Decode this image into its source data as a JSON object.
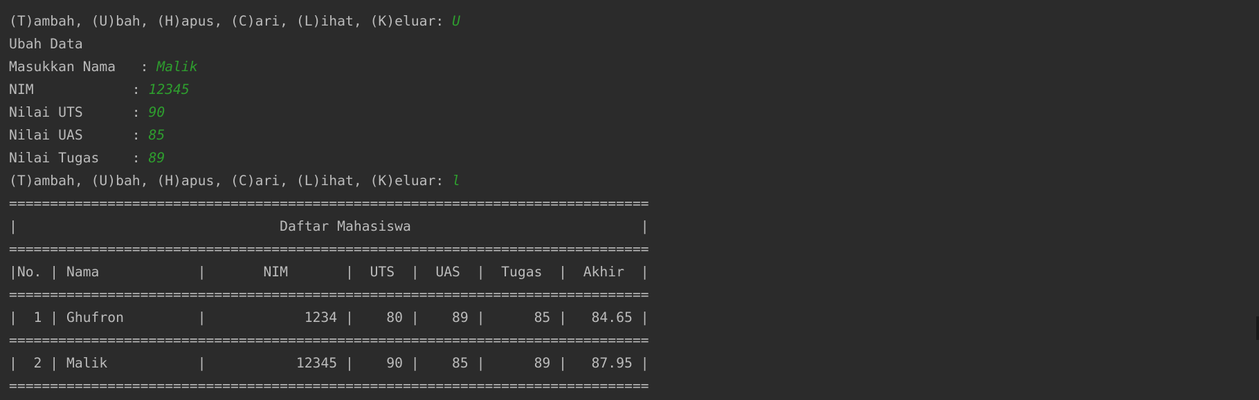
{
  "colors": {
    "background": "#2b2b2b",
    "text": "#bbbbbb",
    "user_input": "#2e9e2e"
  },
  "session": {
    "menu_prompt": "(T)ambah, (U)bah, (H)apus, (C)ari, (L)ihat, (K)eluar: ",
    "menu_choice_1": "U",
    "section_heading": "Ubah Data",
    "form": [
      {
        "label": "Masukkan Nama   : ",
        "value": "Malik"
      },
      {
        "label": "NIM            : ",
        "value": "12345"
      },
      {
        "label": "Nilai UTS      : ",
        "value": "90"
      },
      {
        "label": "Nilai UAS      : ",
        "value": "85"
      },
      {
        "label": "Nilai Tugas    : ",
        "value": "89"
      }
    ],
    "menu_choice_2": "l"
  },
  "table": {
    "border": "==============================================================================",
    "title_row": "|                                Daftar Mahasiswa                            |",
    "header_row": "|No. | Nama            |       NIM       |  UTS  |  UAS  |  Tugas  |  Akhir  |",
    "rows": [
      "|  1 | Ghufron         |            1234 |    80 |    89 |      85 |   84.65 |",
      "|  2 | Malik           |           12345 |    90 |    85 |      89 |   87.95 |"
    ]
  }
}
